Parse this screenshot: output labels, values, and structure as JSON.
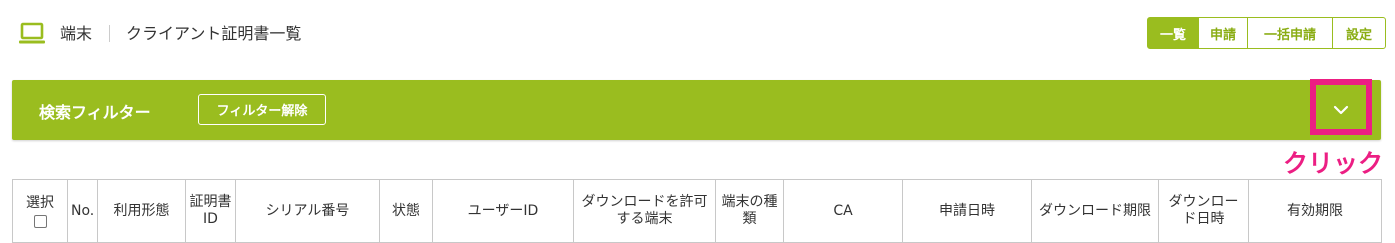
{
  "header": {
    "breadcrumb_device": "端末",
    "breadcrumb_title": "クライアント証明書一覧",
    "icon": "laptop-icon"
  },
  "nav_tabs": [
    {
      "label": "一覧",
      "active": true
    },
    {
      "label": "申請",
      "active": false
    },
    {
      "label": "一括申請",
      "active": false
    },
    {
      "label": "設定",
      "active": false
    }
  ],
  "filter": {
    "title": "検索フィルター",
    "clear_label": "フィルター解除",
    "toggle_icon": "chevron-down-icon"
  },
  "annotation": {
    "text": "クリック",
    "color": "#ec1e83"
  },
  "table": {
    "select_label": "選択",
    "columns": [
      "選択",
      "No.",
      "利用形態",
      "証明書ID",
      "シリアル番号",
      "状態",
      "ユーザーID",
      "ダウンロードを許可する端末",
      "端末の種類",
      "CA",
      "申請日時",
      "ダウンロード期限",
      "ダウンロード日時",
      "有効期限"
    ]
  },
  "colors": {
    "accent": "#9abd1f",
    "accent_text": "#8aad14",
    "highlight": "#ec1e83"
  }
}
